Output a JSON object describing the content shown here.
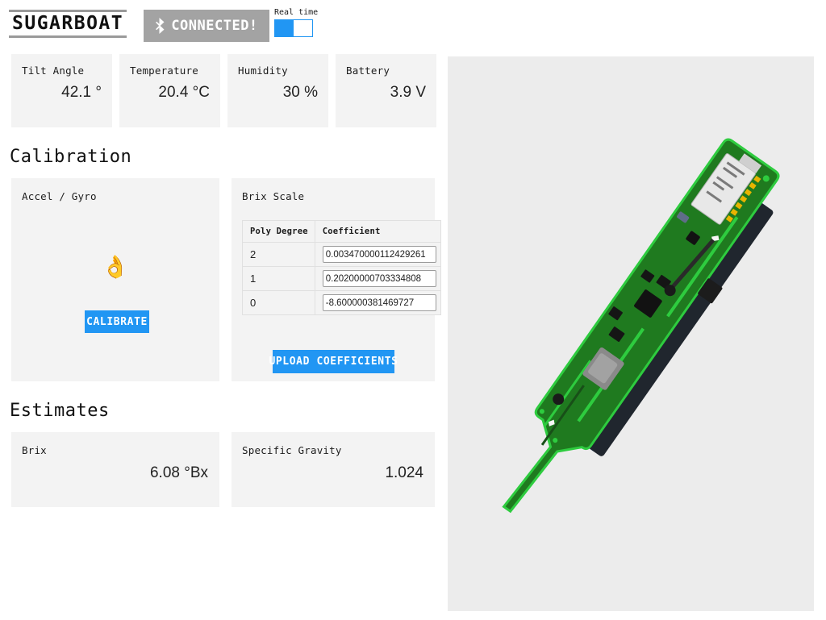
{
  "header": {
    "logo": "SUGARBOAT",
    "connection_status": "CONNECTED!",
    "bluetooth_icon": "bluetooth-icon",
    "realtime_label": "Real time",
    "realtime_on": true,
    "accent_color": "#2196f3",
    "banner_color": "#a3a3a3"
  },
  "stats": [
    {
      "label": "Tilt Angle",
      "value": "42.1 °"
    },
    {
      "label": "Temperature",
      "value": "20.4 °C"
    },
    {
      "label": "Humidity",
      "value": "30 %"
    },
    {
      "label": "Battery",
      "value": "3.9 V"
    }
  ],
  "calibration": {
    "section_title": "Calibration",
    "accel": {
      "title": "Accel / Gyro",
      "status_emoji": "👌",
      "button_label": "CALIBRATE"
    },
    "brix": {
      "title": "Brix Scale",
      "columns": [
        "Poly Degree",
        "Coefficient"
      ],
      "rows": [
        {
          "degree": "2",
          "coefficient": "0.003470000112429261"
        },
        {
          "degree": "1",
          "coefficient": "0.20200000703334808"
        },
        {
          "degree": "0",
          "coefficient": "-8.600000381469727"
        }
      ],
      "upload_label": "UPLOAD COEFFICIENTS"
    }
  },
  "estimates": {
    "section_title": "Estimates",
    "cards": [
      {
        "label": "Brix",
        "value": "6.08 °Bx"
      },
      {
        "label": "Specific Gravity",
        "value": "1.024"
      }
    ]
  },
  "viewer": {
    "name": "pcb-3d-model-viewer",
    "background": "#ececec",
    "model": {
      "board_color": "#1f7a1f",
      "board_edge_color": "#2ecc3f",
      "battery_color": "#1565d8",
      "module_color": "#e8e8e8",
      "connector_color": "#8a8a8a",
      "component_color": "#1a1a1a",
      "pad_color": "#e8b400"
    }
  }
}
